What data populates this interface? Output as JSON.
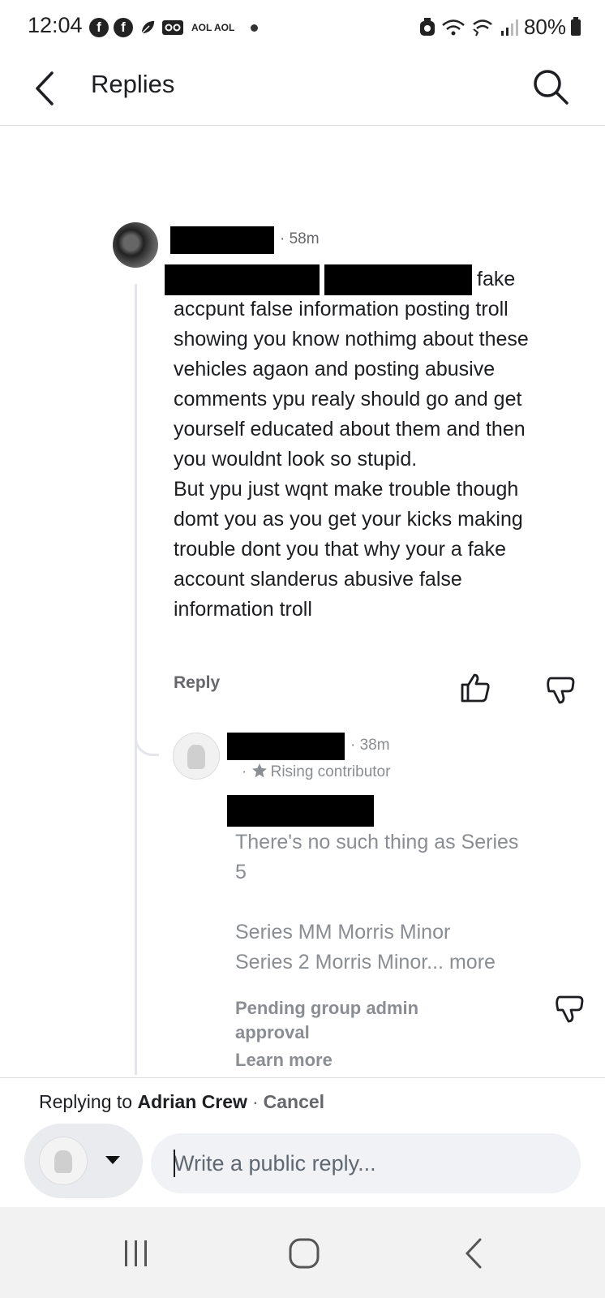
{
  "status_bar": {
    "time": "12:04",
    "aol_label": "AOL AOL",
    "battery": "80%",
    "icons": [
      "facebook-icon",
      "facebook-icon",
      "leaf-icon",
      "voicemail-icon",
      "alarm-icon",
      "wifi-icon",
      "wifi-calling-icon",
      "signal-icon",
      "battery-icon"
    ]
  },
  "header": {
    "title": "Replies",
    "back_icon": "back-arrow-icon",
    "search_icon": "search-icon"
  },
  "comment": {
    "time": "· 58m",
    "text_first_line_end": "fake",
    "text": "accpunt false information posting troll showing you know nothimg about these vehicles agaon and posting abusive comments ypu realy should go and get yourself educated about them and then you wouldnt look so stupid.\nBut ypu just wqnt make trouble though domt you as you get your kicks making trouble dont you that why your a fake account slanderus abusive false information troll",
    "reply_label": "Reply"
  },
  "reply": {
    "time": "· 38m",
    "badge": "Rising contributor",
    "badge_prefix": "·",
    "text_line1": "There's no such thing as Series",
    "text_line2": "5",
    "text_line3": "Series MM Morris Minor",
    "text_line4": "Series 2 Morris Minor...",
    "more": "more",
    "pending": "Pending group admin approval",
    "learn_more": "Learn more"
  },
  "composer": {
    "replying_prefix": "Replying to",
    "replying_name": "Adrian Crew",
    "separator": "·",
    "cancel": "Cancel",
    "placeholder": "Write a public reply..."
  },
  "colors": {
    "redaction": "#000000",
    "secondary_text": "#65676b",
    "pending_text": "#8a8d91"
  }
}
